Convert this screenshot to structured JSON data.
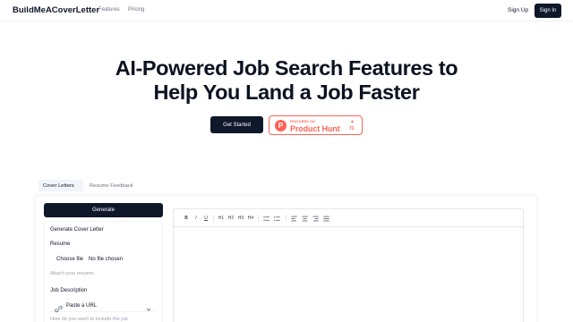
{
  "header": {
    "brand": "BuildMeACoverLetter",
    "nav": [
      "Features",
      "Pricing"
    ],
    "signup": "Sign Up",
    "signin": "Sign In"
  },
  "hero": {
    "title_line1": "AI-Powered Job Search Features to",
    "title_line2": "Help You Land a Job Faster",
    "cta": "Get Started",
    "producthunt": {
      "small": "FEATURED ON",
      "name": "Product Hunt",
      "count": "71",
      "logo_letter": "P"
    }
  },
  "tabs": [
    {
      "label": "Cover Letters",
      "active": true
    },
    {
      "label": "Resume Feedback",
      "active": false
    }
  ],
  "form": {
    "generate": "Generate",
    "section_title": "Generate Cover Letter",
    "resume_label": "Resume",
    "file_button": "Choose file",
    "file_status": "No file chosen",
    "resume_hint": "Attach your resume.",
    "job_desc_label": "Job Description",
    "job_desc_select": "Paste a URL",
    "job_desc_hint": "How do you want to include the job"
  },
  "editor": {
    "toolbar": [
      "B",
      "I",
      "U",
      "H1",
      "H2",
      "H3",
      "H4",
      "list-bullet-icon",
      "list-numbered-icon",
      "align-left-icon",
      "align-center-icon",
      "align-right-icon",
      "align-justify-icon"
    ],
    "content": ""
  },
  "colors": {
    "primary": "#0f172a",
    "producthunt": "#ff6154",
    "muted": "#6b7280"
  }
}
